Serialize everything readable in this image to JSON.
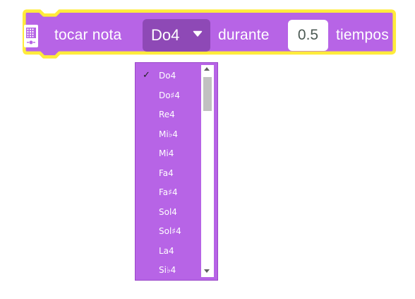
{
  "block": {
    "label_play": "tocar nota",
    "selected_note": "Do4",
    "label_during": "durante",
    "duration_value": "0.5",
    "label_beats": "tiempos",
    "icon": "device-icon",
    "colors": {
      "block": "#b764e6",
      "outline": "#ffeb3b",
      "dropdown": "#8e49b6"
    }
  },
  "menu": {
    "checked_index": 0,
    "check_mark": "✓",
    "items": [
      {
        "label": "Do4"
      },
      {
        "label": "Do♯4"
      },
      {
        "label": "Re4"
      },
      {
        "label": "Mi♭4"
      },
      {
        "label": "Mi4"
      },
      {
        "label": "Fa4"
      },
      {
        "label": "Fa♯4"
      },
      {
        "label": "Sol4"
      },
      {
        "label": "Sol♯4"
      },
      {
        "label": "La4"
      },
      {
        "label": "Si♭4"
      }
    ]
  }
}
